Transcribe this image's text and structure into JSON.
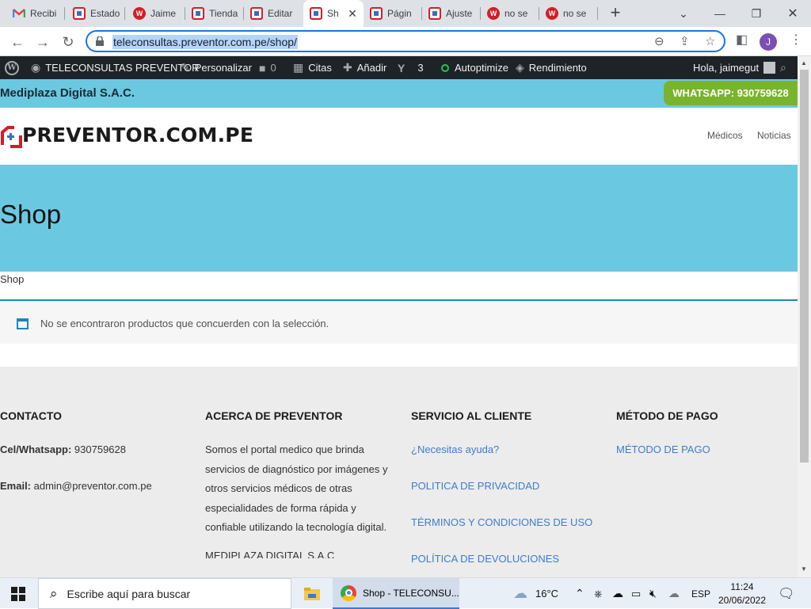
{
  "browser": {
    "tabs": [
      {
        "title": "Recibi",
        "icon": "gmail-icon"
      },
      {
        "title": "Estado",
        "icon": "preventor-icon"
      },
      {
        "title": "Jaime",
        "icon": "w-icon"
      },
      {
        "title": "Tienda",
        "icon": "preventor-icon"
      },
      {
        "title": "Editar",
        "icon": "preventor-icon"
      },
      {
        "title": "Sh",
        "icon": "preventor-icon",
        "active": true
      },
      {
        "title": "Págin",
        "icon": "preventor-icon"
      },
      {
        "title": "Ajuste",
        "icon": "preventor-icon"
      },
      {
        "title": "no se",
        "icon": "w-icon"
      },
      {
        "title": "no se",
        "icon": "w-icon"
      }
    ],
    "url": "teleconsultas.preventor.com.pe/shop/",
    "profile_initial": "J"
  },
  "adminbar": {
    "site": "TELECONSULTAS PREVENTOR",
    "customize": "Personalizar",
    "comments": "0",
    "citas": "Citas",
    "add": "Añadir",
    "yoast_count": "3",
    "autoptimize": "Autoptimize",
    "performance": "Rendimiento",
    "greeting": "Hola, jaimegut"
  },
  "site": {
    "company": "Mediplaza Digital S.A.C.",
    "whatsapp": "WHATSAPP: 930759628",
    "logo_text": "PREVENTOR.COM.PE",
    "nav": [
      "Médicos",
      "Noticias"
    ],
    "page_title": "Shop",
    "breadcrumb": "Shop",
    "notice": "No se encontraron productos que concuerden con la selección."
  },
  "footer": {
    "contact": {
      "heading": "CONTACTO",
      "phone_label": "Cel/Whatsapp:",
      "phone": "930759628",
      "email_label": "Email:",
      "email": "admin@preventor.com.pe"
    },
    "about": {
      "heading": "ACERCA DE PREVENTOR",
      "text": "Somos el portal medico que brinda servicios de diagnóstico por imágenes y otros servicios médicos de otras especialidades de forma rápida y confiable utilizando la tecnología digital.",
      "partial": "MEDIPLAZA DIGITAL S.A.C"
    },
    "service": {
      "heading": "SERVICIO AL CLIENTE",
      "links": [
        "¿Necesitas ayuda?",
        "POLITICA DE PRIVACIDAD",
        "TÉRMINOS Y CONDICIONES DE USO",
        "POLÍTICA DE DEVOLUCIONES"
      ]
    },
    "payment": {
      "heading": "MÉTODO DE PAGO",
      "links": [
        "MÉTODO DE PAGO"
      ]
    }
  },
  "taskbar": {
    "search_placeholder": "Escribe aquí para buscar",
    "chrome_title": "Shop - TELECONSU...",
    "temperature": "16°C",
    "language": "ESP",
    "time": "11:24",
    "date": "20/06/2022"
  }
}
